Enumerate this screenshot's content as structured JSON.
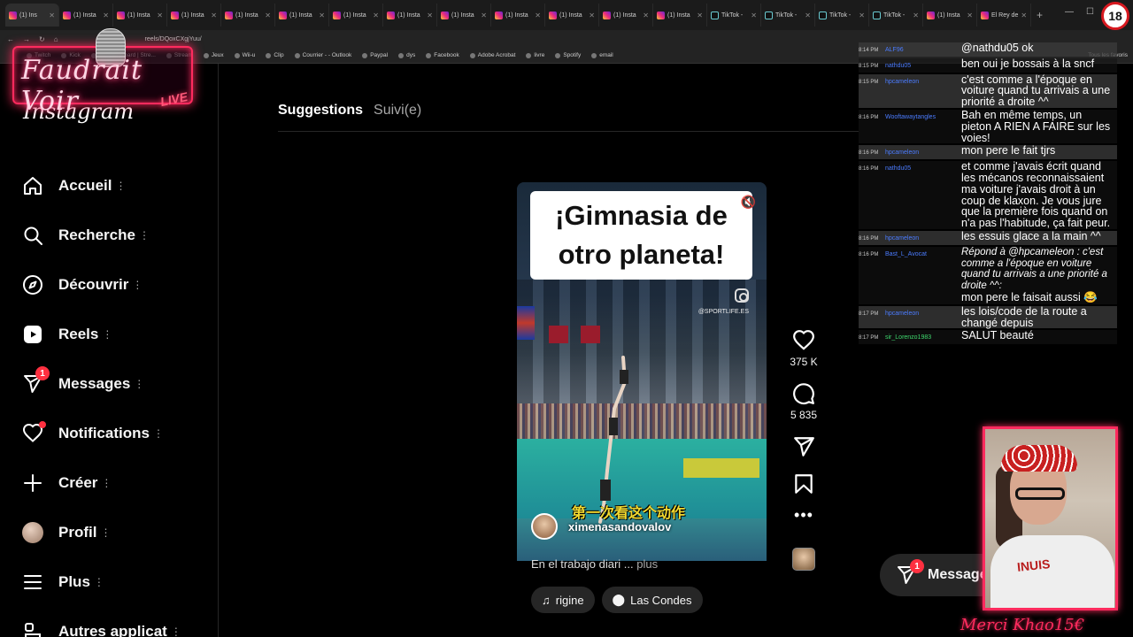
{
  "browser": {
    "tabs": [
      {
        "label": "(1) Ins",
        "kind": "ig",
        "active": true
      },
      {
        "label": "(1) Insta",
        "kind": "ig"
      },
      {
        "label": "(1) Insta",
        "kind": "ig"
      },
      {
        "label": "(1) Insta",
        "kind": "ig"
      },
      {
        "label": "(1) Insta",
        "kind": "ig"
      },
      {
        "label": "(1) Insta",
        "kind": "ig"
      },
      {
        "label": "(1) Insta",
        "kind": "ig"
      },
      {
        "label": "(1) Insta",
        "kind": "ig"
      },
      {
        "label": "(1) Insta",
        "kind": "ig"
      },
      {
        "label": "(1) Insta",
        "kind": "ig"
      },
      {
        "label": "(1) Insta",
        "kind": "ig"
      },
      {
        "label": "(1) Insta",
        "kind": "ig"
      },
      {
        "label": "(1) Insta",
        "kind": "ig"
      },
      {
        "label": "TikTok -",
        "kind": "tt"
      },
      {
        "label": "TikTok -",
        "kind": "tt"
      },
      {
        "label": "TikTok -",
        "kind": "tt"
      },
      {
        "label": "TikTok -",
        "kind": "tt"
      },
      {
        "label": "(1) Insta",
        "kind": "ig"
      },
      {
        "label": "El Rey de",
        "kind": "ig"
      }
    ],
    "url": "reels/DQoxCXgjYuu/",
    "bookmarks": [
      "Twitch",
      "Kick",
      "(4) Dashboard | Stre...",
      "Stream",
      "Jeux",
      "Wii-u",
      "Clip",
      "Courrier - - Outlook",
      "Paypal",
      "dys",
      "Facebook",
      "Adobe Acrobat",
      "livre",
      "Spotify",
      "email"
    ],
    "bookmarks_right": "Tous les favoris"
  },
  "overlay": {
    "logo_text": "Faudrait Voir",
    "logo_live": "LIVE",
    "age_badge": "18",
    "donation": "Merci Khao15€"
  },
  "instagram": {
    "brand": "Instagram",
    "nav": [
      {
        "id": "home",
        "label": "Accueil",
        "icon": "home-icon"
      },
      {
        "id": "search",
        "label": "Recherche",
        "icon": "search-icon"
      },
      {
        "id": "explore",
        "label": "Découvrir",
        "icon": "compass-icon"
      },
      {
        "id": "reels",
        "label": "Reels",
        "icon": "reels-icon"
      },
      {
        "id": "messages",
        "label": "Messages",
        "icon": "messenger-icon",
        "badge": "1"
      },
      {
        "id": "notifications",
        "label": "Notifications",
        "icon": "heart-icon"
      },
      {
        "id": "create",
        "label": "Créer",
        "icon": "plus-icon"
      },
      {
        "id": "profile",
        "label": "Profil",
        "icon": "avatar-icon"
      },
      {
        "id": "more",
        "label": "Plus",
        "icon": "menu-icon"
      },
      {
        "id": "apps",
        "label": "Autres applicat",
        "icon": "apps-icon"
      }
    ],
    "feed_tabs": {
      "suggestions": "Suggestions",
      "following": "Suivi(e)"
    },
    "reel": {
      "title": "¡Gimnasia de otro planeta!",
      "credit": "@SPORTLIFE.ES",
      "subtitle_cn": "第一次看这个动作",
      "author": "ximenasandovalov",
      "caption": "En el trabajo diari ...",
      "caption_more": "plus",
      "audio_chip": "rigine",
      "location_chip": "Las Condes"
    },
    "actions": {
      "likes": "375 K",
      "comments": "5 835"
    },
    "messages_pill": {
      "label": "Messages",
      "badge": "1"
    }
  },
  "chat": [
    {
      "time": "8:14 PM",
      "user": "ALF96",
      "msg": "@nathdu05 ok"
    },
    {
      "time": "8:15 PM",
      "user": "nathdu05",
      "msg": "ben oui je bossais à la sncf"
    },
    {
      "time": "8:15 PM",
      "user": "hpcameleon",
      "msg": "c'est comme a l'époque en voiture quand tu arrivais a une priorité a droite ^^"
    },
    {
      "time": "8:16 PM",
      "user": "Wooftawaytangles",
      "msg": "Bah en même temps, un pieton A RIEN A FAIRE sur les voies!"
    },
    {
      "time": "8:16 PM",
      "user": "hpcameleon",
      "msg": "mon pere le fait tjrs"
    },
    {
      "time": "8:16 PM",
      "user": "nathdu05",
      "msg": "et comme j'avais écrit quand les mécanos reconnaissaient ma voiture j'avais droit à un coup de klaxon. Je vous jure que la première fois quand on n'a pas l'habitude, ça fait peur."
    },
    {
      "time": "8:16 PM",
      "user": "hpcameleon",
      "msg": "les essuis glace a la main ^^"
    },
    {
      "time": "8:16 PM",
      "user": "Bast_L_Avocat",
      "msg": "Répond à @hpcameleon : c'est comme a l'époque en voiture quand tu arrivais a une priorité a droite ^^:",
      "reply": "mon pere le faisait aussi 😂"
    },
    {
      "time": "8:17 PM",
      "user": "hpcameleon",
      "msg": "les lois/code de la route a changé depuis"
    },
    {
      "time": "8:17 PM",
      "user": "sir_Lorenzo1983",
      "msg": "SALUT beauté",
      "green": true
    }
  ],
  "webcam": {
    "shirt_text": "INUIS"
  }
}
